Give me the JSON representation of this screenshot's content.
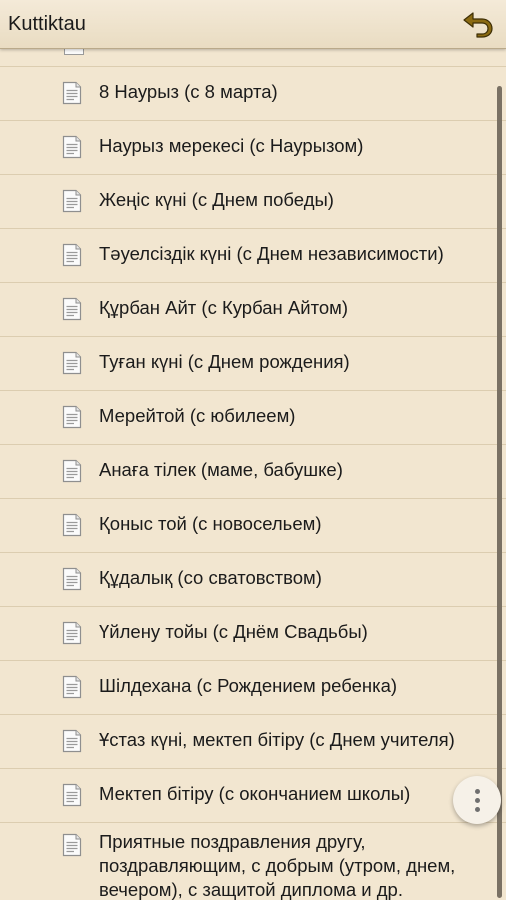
{
  "app_bar": {
    "title": "Kuttiktau",
    "back_icon": "back-arrow-icon",
    "accent": "#8a6a12"
  },
  "list": {
    "items": [
      {
        "label": "8 Наурыз (с 8 марта)",
        "icon": "document-icon"
      },
      {
        "label": "Наурыз мерекесі (с Наурызом)",
        "icon": "document-icon"
      },
      {
        "label": "Жеңіс күні (с Днем победы)",
        "icon": "document-icon"
      },
      {
        "label": "Тәуелсіздік күні (с Днем независимости)",
        "icon": "document-icon"
      },
      {
        "label": "Құрбан Айт (с Курбан Айтом)",
        "icon": "document-icon"
      },
      {
        "label": "Туған күні (с Днем рождения)",
        "icon": "document-icon"
      },
      {
        "label": "Мерейтой (с юбилеем)",
        "icon": "document-icon"
      },
      {
        "label": "Анаға тілек (маме, бабушке)",
        "icon": "document-icon"
      },
      {
        "label": "Қоныс той (с новосельем)",
        "icon": "document-icon"
      },
      {
        "label": "Құдалық (со сватовством)",
        "icon": "document-icon"
      },
      {
        "label": "Үйлену тойы (с Днём Свадьбы)",
        "icon": "document-icon"
      },
      {
        "label": "Шілдехана (с Рождением ребенка)",
        "icon": "document-icon"
      },
      {
        "label": "Ұстаз күні, мектеп бітіру (с Днем учителя)",
        "icon": "document-icon"
      },
      {
        "label": "Мектеп бітіру (с окончанием школы)",
        "icon": "document-icon"
      },
      {
        "label": "Приятные поздравления другу, поздравляющим, с добрым (утром, днем, вечером), с защитой диплома и др.",
        "icon": "document-icon"
      }
    ]
  },
  "fab": {
    "icon": "more-vertical-icon"
  }
}
